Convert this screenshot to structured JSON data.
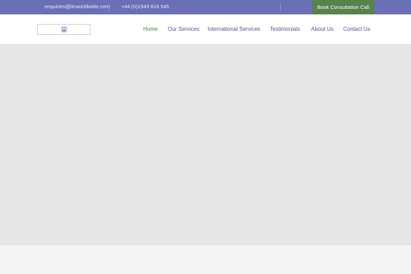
{
  "topbar": {
    "email": "enquiries@ltcworldwide.com",
    "phone": "+44 (0)1943 816 545",
    "cta_label": "Book Consultation Call"
  },
  "nav": {
    "items": [
      {
        "label": "Home",
        "active": true
      },
      {
        "label": "Our Services",
        "active": false
      },
      {
        "label": "International Services",
        "active": false
      },
      {
        "label": "Testimonials",
        "active": false
      },
      {
        "label": "About Us",
        "active": false
      },
      {
        "label": "Contact Us",
        "active": false
      }
    ]
  },
  "colors": {
    "topbar_bg": "#6a6fb6",
    "cta_bg": "#56834a",
    "nav_text": "#4e5298",
    "nav_active": "#4f7e3e",
    "hero_bg": "#e6e6e6"
  }
}
